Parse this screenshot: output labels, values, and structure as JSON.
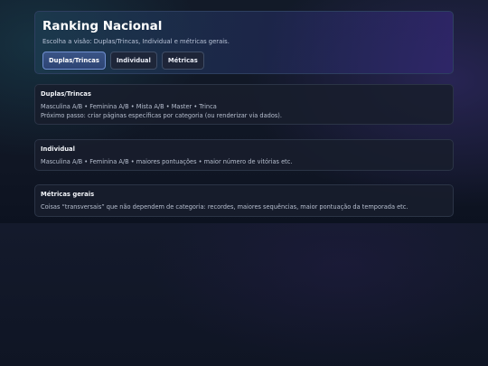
{
  "header": {
    "title": "Ranking Nacional",
    "subtitle": "Escolha a visão: Duplas/Trincas, Individual e métricas gerais."
  },
  "tabs": [
    {
      "label": "Duplas/Trincas",
      "active": true
    },
    {
      "label": "Individual",
      "active": false
    },
    {
      "label": "Métricas",
      "active": false
    }
  ],
  "sections": {
    "duplas": {
      "title": "Duplas/Trincas",
      "lines": [
        "Masculina A/B • Feminina A/B • Mista A/B • Master • Trinca",
        "Próximo passo: criar páginas específicas por categoria (ou renderizar via dados)."
      ]
    },
    "individual": {
      "title": "Individual",
      "lines": [
        "Masculina A/B • Feminina A/B • maiores pontuações • maior número de vitórias etc."
      ]
    },
    "metricas": {
      "title": "Métricas gerais",
      "lines": [
        "Coisas “transversais” que não dependem de categoria: recordes, maiores sequências, maior pontuação da temporada etc."
      ]
    }
  },
  "colors": {
    "accent": "#3a5486",
    "background": "#101624",
    "card": "#181e2c"
  }
}
